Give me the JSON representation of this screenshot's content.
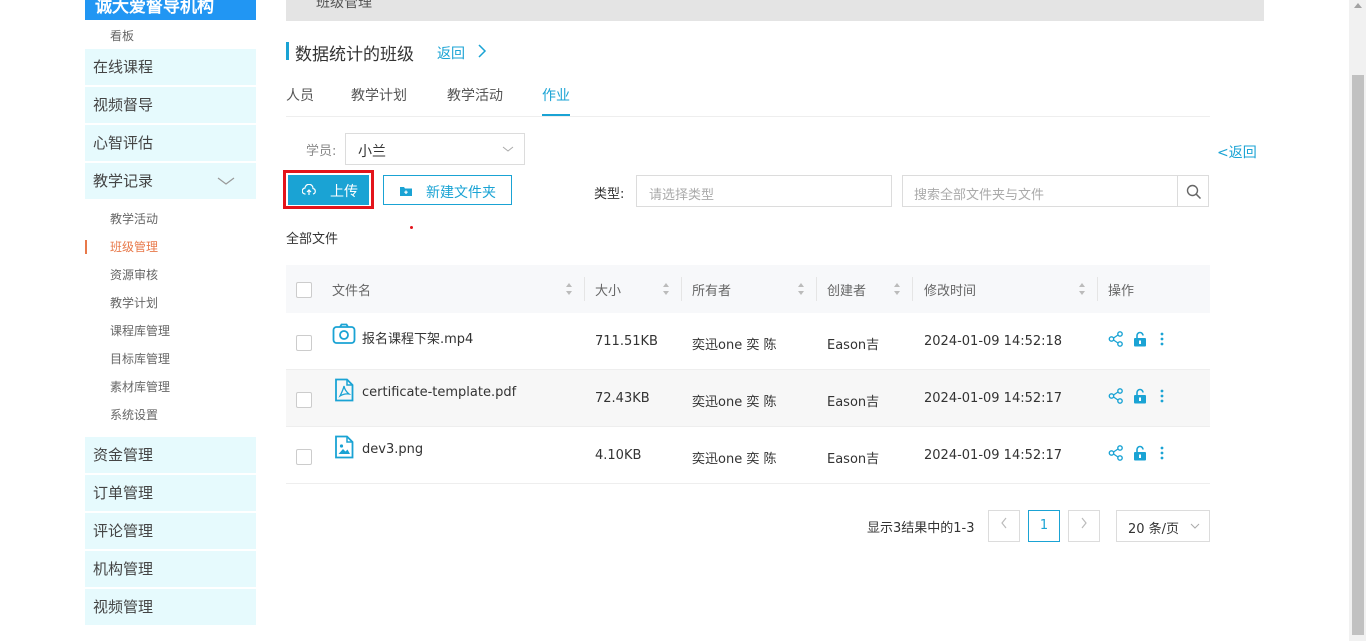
{
  "sidebar": {
    "brand": "诚大爱督导机构",
    "top_sub": "看板",
    "menus_top": [
      {
        "label": "在线课程"
      },
      {
        "label": "视频督导"
      },
      {
        "label": "心智评估"
      },
      {
        "label": "教学记录"
      }
    ],
    "sub_items": [
      {
        "label": "教学活动"
      },
      {
        "label": "班级管理"
      },
      {
        "label": "资源审核"
      },
      {
        "label": "教学计划"
      },
      {
        "label": "课程库管理"
      },
      {
        "label": "目标库管理"
      },
      {
        "label": "素材库管理"
      },
      {
        "label": "系统设置"
      }
    ],
    "menus_bottom": [
      {
        "label": "资金管理"
      },
      {
        "label": "订单管理"
      },
      {
        "label": "评论管理"
      },
      {
        "label": "机构管理"
      },
      {
        "label": "视频管理"
      }
    ],
    "active_color": "#e8794a",
    "menu_bg": "#e6fafd"
  },
  "topbar": {
    "breadcrumb": "班级管理"
  },
  "header": {
    "title": "数据统计的班级",
    "back_label": "返回"
  },
  "tabs": [
    {
      "label": "人员"
    },
    {
      "label": "教学计划"
    },
    {
      "label": "教学活动"
    },
    {
      "label": "作业"
    }
  ],
  "filters": {
    "student_label": "学员:",
    "student_value": "小兰",
    "back_right": "<返回",
    "upload_label": "上传",
    "new_folder_label": "新建文件夹",
    "type_label": "类型:",
    "type_placeholder": "请选择类型",
    "search_placeholder": "搜索全部文件夹与文件"
  },
  "all_files_label": "全部文件",
  "table": {
    "headers": [
      "文件名",
      "大小",
      "所有者",
      "创建者",
      "修改时间",
      "操作"
    ],
    "rows": [
      {
        "name": "报名课程下架.mp4",
        "icon": "video-file-icon",
        "size": "711.51KB",
        "owner": "奕迅one 奕 陈",
        "creator": "Eason吉",
        "modified": "2024-01-09 14:52:18"
      },
      {
        "name": "certificate-template.pdf",
        "icon": "pdf-file-icon",
        "size": "72.43KB",
        "owner": "奕迅one 奕 陈",
        "creator": "Eason吉",
        "modified": "2024-01-09 14:52:17"
      },
      {
        "name": "dev3.png",
        "icon": "image-file-icon",
        "size": "4.10KB",
        "owner": "奕迅one 奕 陈",
        "creator": "Eason吉",
        "modified": "2024-01-09 14:52:17"
      }
    ]
  },
  "pagination": {
    "summary": "显示3结果中的1-3",
    "current_page": "1",
    "page_size": "20 条/页"
  },
  "accent_color": "#1aa3d4"
}
